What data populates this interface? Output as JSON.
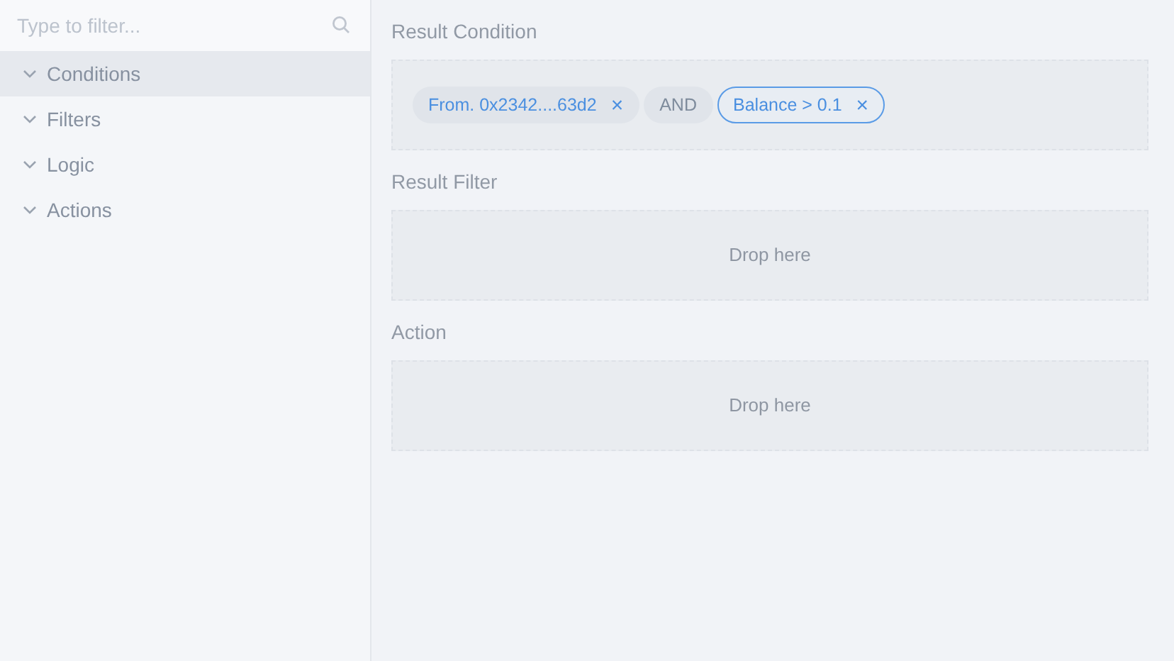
{
  "sidebar": {
    "search": {
      "placeholder": "Type to filter..."
    },
    "items": [
      {
        "label": "Conditions",
        "expanded": false,
        "selected": true
      },
      {
        "label": "Filters",
        "expanded": false,
        "selected": false
      },
      {
        "label": "Logic",
        "expanded": false,
        "selected": false
      },
      {
        "label": "Actions",
        "expanded": false,
        "selected": false
      }
    ]
  },
  "sections": [
    {
      "title": "Result Condition",
      "chips": [
        {
          "kind": "tag",
          "label": "From. 0x2342....63d2",
          "close": "×",
          "selected": false
        },
        {
          "kind": "operator",
          "label": "AND",
          "selected": false
        },
        {
          "kind": "tag",
          "label": "Balance > 0.1",
          "close": "×",
          "selected": true
        }
      ]
    },
    {
      "title": "Result Filter",
      "placeholder": "Drop here"
    },
    {
      "title": "Action",
      "placeholder": "Drop here"
    }
  ]
}
